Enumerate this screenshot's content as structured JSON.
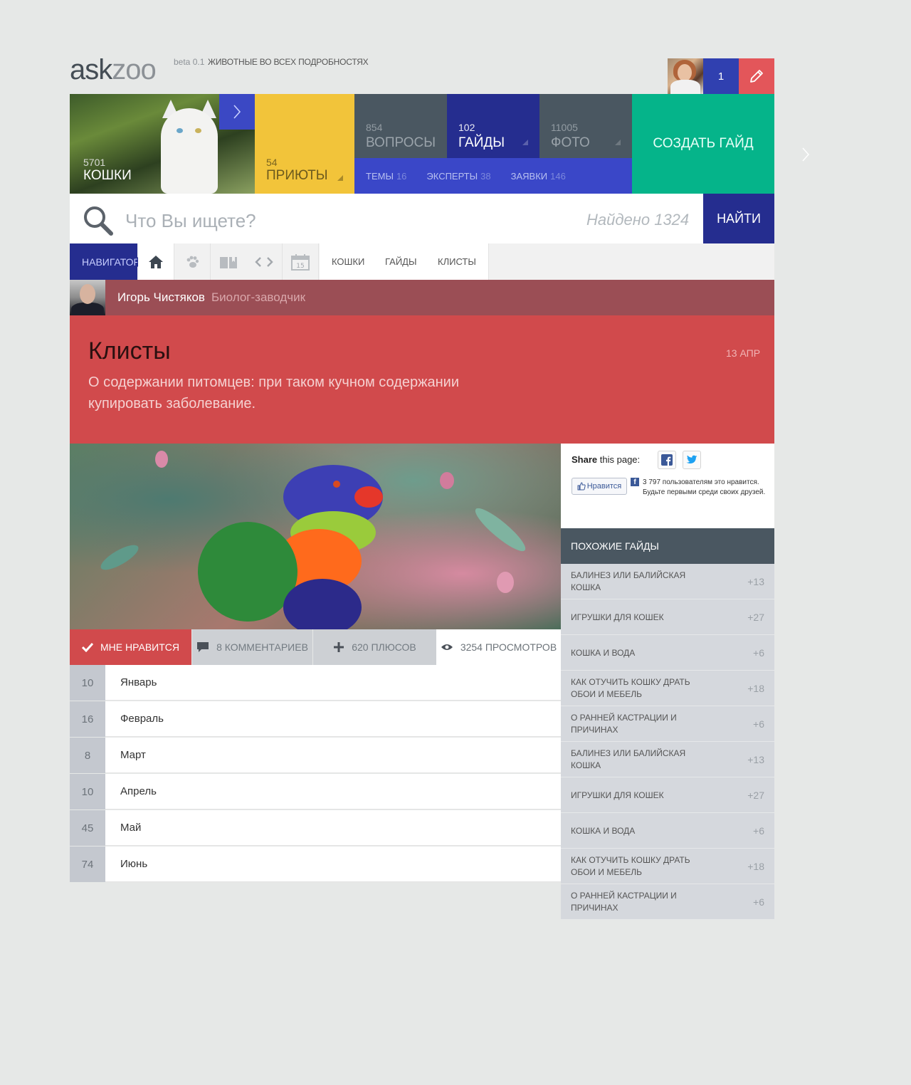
{
  "header": {
    "logo_ask": "ask",
    "logo_zoo": "zoo",
    "beta": "beta 0.1",
    "tagline": "ЖИВОТНЫЕ ВО ВСЕХ ПОДРОБНОСТЯХ",
    "notifications": "1"
  },
  "tiles": {
    "cats": {
      "count": "5701",
      "label": "КОШКИ"
    },
    "shelters": {
      "count": "54",
      "label": "ПРИЮТЫ"
    },
    "questions": {
      "count": "854",
      "label": "ВОПРОСЫ"
    },
    "guides": {
      "count": "102",
      "label": "ГАЙДЫ"
    },
    "photos": {
      "count": "11005",
      "label": "ФОТО"
    },
    "create": "СОЗДАТЬ ГАЙД",
    "sub": [
      {
        "label": "ТЕМЫ",
        "count": "16"
      },
      {
        "label": "ЭКСПЕРТЫ",
        "count": "38"
      },
      {
        "label": "ЗАЯВКИ",
        "count": "146"
      }
    ]
  },
  "search": {
    "placeholder": "Что Вы ищете?",
    "found": "Найдено 1324",
    "button": "НАЙТИ"
  },
  "navigator": {
    "label": "НАВИГАТОР",
    "calendar_day": "15",
    "links": [
      "КОШКИ",
      "ГАЙДЫ",
      "КЛИСТЫ"
    ]
  },
  "author": {
    "name": "Игорь Чистяков",
    "role": "Биолог-заводчик"
  },
  "article": {
    "title": "Клисты",
    "date": "13 АПР",
    "subtitle": "О содержании питомцев: при таком кучном содержании купировать заболевание."
  },
  "stats": {
    "like": "МНЕ НРАВИТСЯ",
    "comments": "8 КОММЕНТАРИЕВ",
    "plus": "620 ПЛЮСОВ",
    "views": "3254 ПРОСМОТРОВ"
  },
  "months": [
    {
      "num": "10",
      "label": "Январь"
    },
    {
      "num": "16",
      "label": "Февраль"
    },
    {
      "num": "8",
      "label": "Март"
    },
    {
      "num": "10",
      "label": "Апрель"
    },
    {
      "num": "45",
      "label": "Май"
    },
    {
      "num": "74",
      "label": "Июнь"
    }
  ],
  "share": {
    "bold": "Share",
    "rest": "this page:",
    "like_button": "Нравится",
    "fb_text": "3 797 пользователям это нравится. Будьте первыми среди своих друзей."
  },
  "similar": {
    "title": "ПОХОЖИЕ ГАЙДЫ",
    "items": [
      {
        "title": "БАЛИНЕЗ ИЛИ БАЛИЙСКАЯ КОШКА",
        "count": "+13"
      },
      {
        "title": "ИГРУШКИ ДЛЯ КОШЕК",
        "count": "+27"
      },
      {
        "title": "КОШКА И ВОДА",
        "count": "+6"
      },
      {
        "title": "КАК ОТУЧИТЬ КОШКУ ДРАТЬ ОБОИ И МЕБЕЛЬ",
        "count": "+18"
      },
      {
        "title": "О РАННЕЙ КАСТРАЦИИ И ПРИЧИНАХ",
        "count": "+6"
      },
      {
        "title": "БАЛИНЕЗ ИЛИ БАЛИЙСКАЯ КОШКА",
        "count": "+13"
      },
      {
        "title": "ИГРУШКИ ДЛЯ КОШЕК",
        "count": "+27"
      },
      {
        "title": "КОШКА И ВОДА",
        "count": "+6"
      },
      {
        "title": "КАК ОТУЧИТЬ КОШКУ ДРАТЬ ОБОИ И МЕБЕЛЬ",
        "count": "+18"
      },
      {
        "title": "О РАННЕЙ КАСТРАЦИИ И ПРИЧИНАХ",
        "count": "+6"
      }
    ]
  },
  "colors": {
    "accent_blue": "#252d8f",
    "accent_red": "#d14a4c",
    "accent_green": "#05b48a",
    "accent_yellow": "#f2c43a"
  }
}
